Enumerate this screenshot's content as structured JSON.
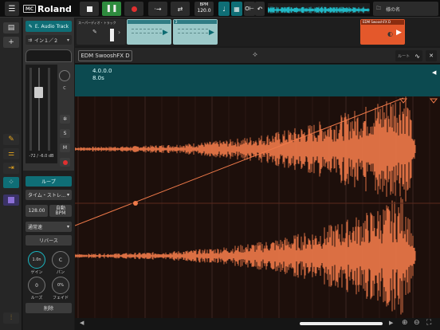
{
  "topbar": {
    "menu_icon": "hamburger-icon",
    "brand": "Roland",
    "brand_mark": "MC",
    "bpm_label": "BPM",
    "bpm_value": "120.0",
    "file_label": "様の名"
  },
  "clips": {
    "track_label": "スーパーディオ・トラック",
    "clip1_name": "",
    "clip2_number": "2",
    "clip3_number": "3",
    "selected_clip": "EDM SwooshFX D"
  },
  "strip": {
    "top_button": "E. Audio Track",
    "input_label": "イン１／２",
    "meter_value": "-72 / -6.0 dB",
    "loop_label": "ループ",
    "stretch_label": "タイム・ストレ...",
    "tempo_value": "128.00",
    "auto_bpm_label": "自動\nBPM",
    "mode_label": "通常速",
    "reverse_label": "リバース",
    "gain_value": "1.0n",
    "gain_label": "ゲイン",
    "pan_value": "C",
    "pan_label": "パン",
    "loose_value": "0",
    "loose_label": "ルーズ",
    "fade_value": "0%",
    "fade_label": "フェイド",
    "delete_label": "削除",
    "solo": "S",
    "mute": "M",
    "pan_knob": "C"
  },
  "editor": {
    "title": "EDM SwooshFX D",
    "mode_label": "ルート",
    "region_start": "4.0.0.0",
    "region_length": "8.0s"
  },
  "colors": {
    "accent": "#0f6e76",
    "waveform": "#f07a4a",
    "clip_orange": "#e4582b"
  }
}
